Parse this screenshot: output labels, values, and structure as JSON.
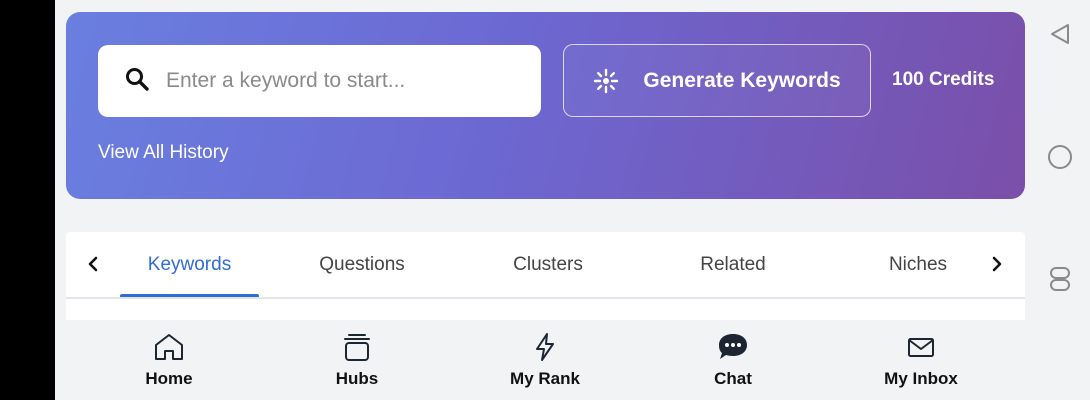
{
  "search": {
    "placeholder": "Enter a keyword to start...",
    "value": ""
  },
  "hero": {
    "generate_label": "Generate Keywords",
    "credits": "100 Credits",
    "history_link": "View All History",
    "gradient_start": "#6a7fe0",
    "gradient_end": "#7a4fa9"
  },
  "tabs": {
    "items": [
      {
        "label": "Keywords",
        "active": true
      },
      {
        "label": "Questions",
        "active": false
      },
      {
        "label": "Clusters",
        "active": false
      },
      {
        "label": "Related",
        "active": false
      },
      {
        "label": "Niches",
        "active": false
      }
    ],
    "active_color": "#2f6bd9"
  },
  "bottom_nav": {
    "items": [
      {
        "label": "Home",
        "icon": "home-icon"
      },
      {
        "label": "Hubs",
        "icon": "hubs-icon"
      },
      {
        "label": "My Rank",
        "icon": "lightning-icon"
      },
      {
        "label": "Chat",
        "icon": "chat-icon"
      },
      {
        "label": "My Inbox",
        "icon": "mail-icon"
      }
    ]
  },
  "system_nav": [
    "back-icon",
    "home-circle-icon",
    "recents-icon"
  ]
}
